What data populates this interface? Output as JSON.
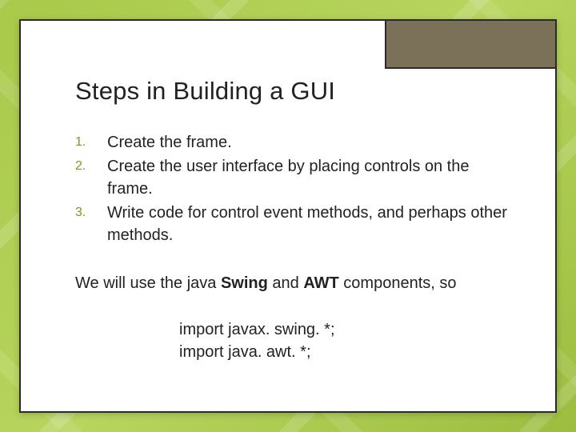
{
  "slide": {
    "title": "Steps in Building a GUI",
    "steps": [
      {
        "num": "1.",
        "text": "Create the frame."
      },
      {
        "num": "2.",
        "text": "Create the user interface by placing controls on the frame."
      },
      {
        "num": "3.",
        "text": "Write code for control event methods, and perhaps other methods."
      }
    ],
    "body_prefix": "We will use the java ",
    "body_bold1": "Swing",
    "body_mid": " and ",
    "body_bold2": "AWT",
    "body_suffix": " components, so",
    "code1": "import javax. swing. *;",
    "code2": "import java. awt. *;"
  }
}
